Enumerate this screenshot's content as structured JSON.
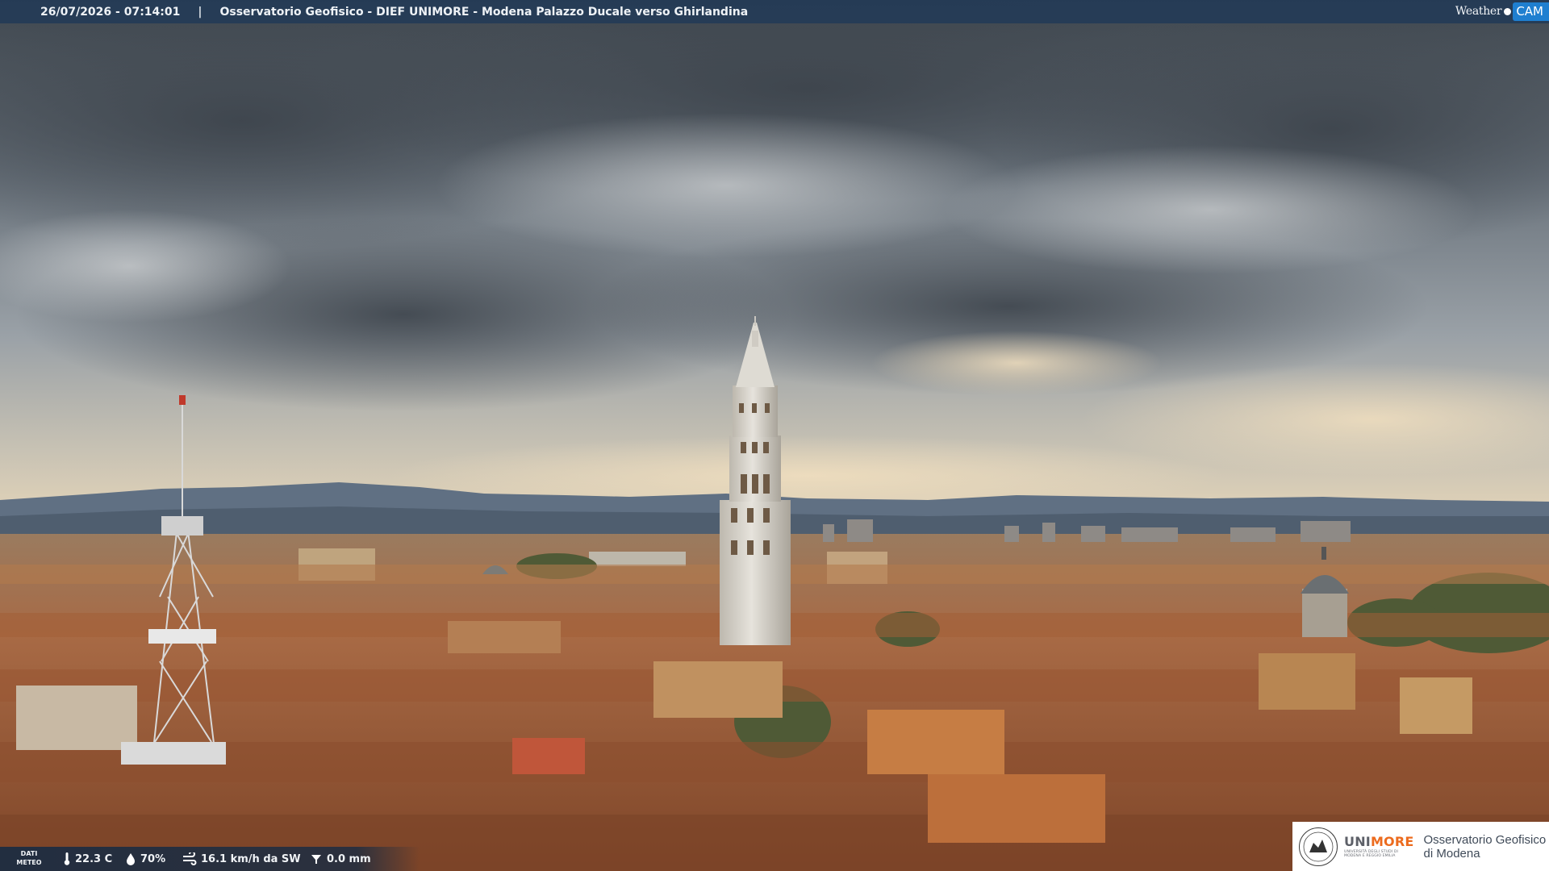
{
  "overlay": {
    "timestamp": "26/07/2026 - 07:14:01",
    "separator": "|",
    "camera_title": "Osservatorio Geofisico - DIEF UNIMORE - Modena Palazzo Ducale verso Ghirlandina",
    "brand_weather": "Weather",
    "brand_cam": "CAM"
  },
  "weather": {
    "label_line1": "DATI",
    "label_line2": "METEO",
    "temperature": "22.3 C",
    "humidity": "70%",
    "wind": "16.1 km/h da SW",
    "rain": "0.0 mm"
  },
  "logo": {
    "uni_prefix": "UNI",
    "uni_suffix": "MORE",
    "uni_subtitle": "UNIVERSITÀ DEGLI STUDI DI MODENA E REGGIO EMILIA",
    "observatory_line1": "Osservatorio Geofisico",
    "observatory_line2": "di Modena"
  },
  "colors": {
    "sky_top": "#4b535c",
    "sky_mid": "#8c949c",
    "horizon": "#d8ccb6",
    "mountains": "#5b6b7c",
    "roofs": "#a5613d",
    "walls": "#c99a60",
    "tower": "#d9d6cf",
    "unimore_orange": "#ec6b1e",
    "bar_bg": "#223a56"
  }
}
